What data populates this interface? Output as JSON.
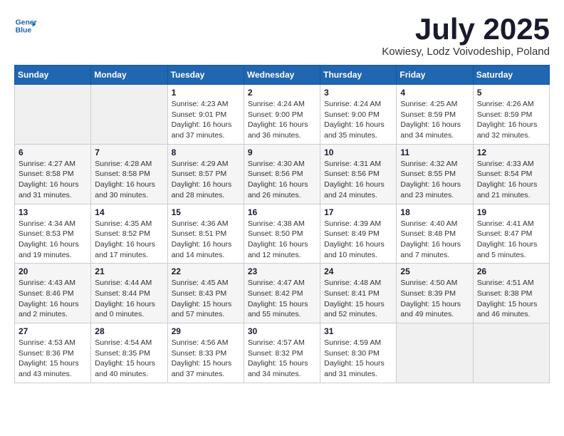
{
  "header": {
    "logo_line1": "General",
    "logo_line2": "Blue",
    "month_year": "July 2025",
    "location": "Kowiesy, Lodz Voivodeship, Poland"
  },
  "weekdays": [
    "Sunday",
    "Monday",
    "Tuesday",
    "Wednesday",
    "Thursday",
    "Friday",
    "Saturday"
  ],
  "weeks": [
    [
      {
        "day": "",
        "info": ""
      },
      {
        "day": "",
        "info": ""
      },
      {
        "day": "1",
        "info": "Sunrise: 4:23 AM\nSunset: 9:01 PM\nDaylight: 16 hours\nand 37 minutes."
      },
      {
        "day": "2",
        "info": "Sunrise: 4:24 AM\nSunset: 9:00 PM\nDaylight: 16 hours\nand 36 minutes."
      },
      {
        "day": "3",
        "info": "Sunrise: 4:24 AM\nSunset: 9:00 PM\nDaylight: 16 hours\nand 35 minutes."
      },
      {
        "day": "4",
        "info": "Sunrise: 4:25 AM\nSunset: 8:59 PM\nDaylight: 16 hours\nand 34 minutes."
      },
      {
        "day": "5",
        "info": "Sunrise: 4:26 AM\nSunset: 8:59 PM\nDaylight: 16 hours\nand 32 minutes."
      }
    ],
    [
      {
        "day": "6",
        "info": "Sunrise: 4:27 AM\nSunset: 8:58 PM\nDaylight: 16 hours\nand 31 minutes."
      },
      {
        "day": "7",
        "info": "Sunrise: 4:28 AM\nSunset: 8:58 PM\nDaylight: 16 hours\nand 30 minutes."
      },
      {
        "day": "8",
        "info": "Sunrise: 4:29 AM\nSunset: 8:57 PM\nDaylight: 16 hours\nand 28 minutes."
      },
      {
        "day": "9",
        "info": "Sunrise: 4:30 AM\nSunset: 8:56 PM\nDaylight: 16 hours\nand 26 minutes."
      },
      {
        "day": "10",
        "info": "Sunrise: 4:31 AM\nSunset: 8:56 PM\nDaylight: 16 hours\nand 24 minutes."
      },
      {
        "day": "11",
        "info": "Sunrise: 4:32 AM\nSunset: 8:55 PM\nDaylight: 16 hours\nand 23 minutes."
      },
      {
        "day": "12",
        "info": "Sunrise: 4:33 AM\nSunset: 8:54 PM\nDaylight: 16 hours\nand 21 minutes."
      }
    ],
    [
      {
        "day": "13",
        "info": "Sunrise: 4:34 AM\nSunset: 8:53 PM\nDaylight: 16 hours\nand 19 minutes."
      },
      {
        "day": "14",
        "info": "Sunrise: 4:35 AM\nSunset: 8:52 PM\nDaylight: 16 hours\nand 17 minutes."
      },
      {
        "day": "15",
        "info": "Sunrise: 4:36 AM\nSunset: 8:51 PM\nDaylight: 16 hours\nand 14 minutes."
      },
      {
        "day": "16",
        "info": "Sunrise: 4:38 AM\nSunset: 8:50 PM\nDaylight: 16 hours\nand 12 minutes."
      },
      {
        "day": "17",
        "info": "Sunrise: 4:39 AM\nSunset: 8:49 PM\nDaylight: 16 hours\nand 10 minutes."
      },
      {
        "day": "18",
        "info": "Sunrise: 4:40 AM\nSunset: 8:48 PM\nDaylight: 16 hours\nand 7 minutes."
      },
      {
        "day": "19",
        "info": "Sunrise: 4:41 AM\nSunset: 8:47 PM\nDaylight: 16 hours\nand 5 minutes."
      }
    ],
    [
      {
        "day": "20",
        "info": "Sunrise: 4:43 AM\nSunset: 8:46 PM\nDaylight: 16 hours\nand 2 minutes."
      },
      {
        "day": "21",
        "info": "Sunrise: 4:44 AM\nSunset: 8:44 PM\nDaylight: 16 hours\nand 0 minutes."
      },
      {
        "day": "22",
        "info": "Sunrise: 4:45 AM\nSunset: 8:43 PM\nDaylight: 15 hours\nand 57 minutes."
      },
      {
        "day": "23",
        "info": "Sunrise: 4:47 AM\nSunset: 8:42 PM\nDaylight: 15 hours\nand 55 minutes."
      },
      {
        "day": "24",
        "info": "Sunrise: 4:48 AM\nSunset: 8:41 PM\nDaylight: 15 hours\nand 52 minutes."
      },
      {
        "day": "25",
        "info": "Sunrise: 4:50 AM\nSunset: 8:39 PM\nDaylight: 15 hours\nand 49 minutes."
      },
      {
        "day": "26",
        "info": "Sunrise: 4:51 AM\nSunset: 8:38 PM\nDaylight: 15 hours\nand 46 minutes."
      }
    ],
    [
      {
        "day": "27",
        "info": "Sunrise: 4:53 AM\nSunset: 8:36 PM\nDaylight: 15 hours\nand 43 minutes."
      },
      {
        "day": "28",
        "info": "Sunrise: 4:54 AM\nSunset: 8:35 PM\nDaylight: 15 hours\nand 40 minutes."
      },
      {
        "day": "29",
        "info": "Sunrise: 4:56 AM\nSunset: 8:33 PM\nDaylight: 15 hours\nand 37 minutes."
      },
      {
        "day": "30",
        "info": "Sunrise: 4:57 AM\nSunset: 8:32 PM\nDaylight: 15 hours\nand 34 minutes."
      },
      {
        "day": "31",
        "info": "Sunrise: 4:59 AM\nSunset: 8:30 PM\nDaylight: 15 hours\nand 31 minutes."
      },
      {
        "day": "",
        "info": ""
      },
      {
        "day": "",
        "info": ""
      }
    ]
  ]
}
